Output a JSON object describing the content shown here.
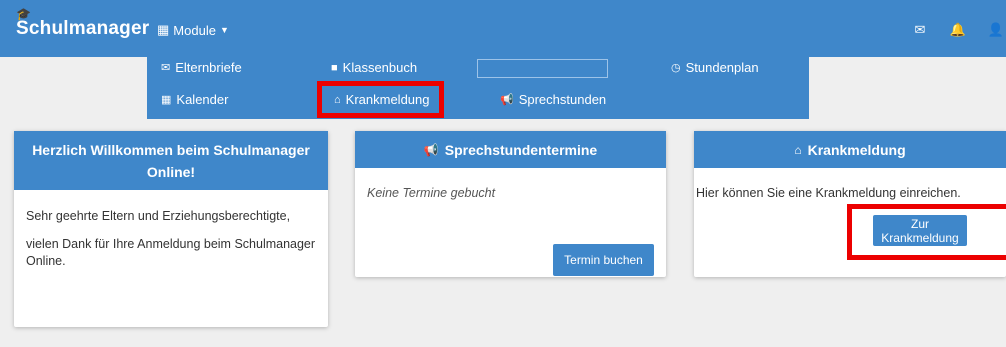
{
  "navbar": {
    "brand": "Schulmanager",
    "module_label": "Module",
    "icons": [
      "envelope-icon",
      "bell-icon",
      "user-icon"
    ]
  },
  "menu": {
    "items": [
      {
        "name": "elternbriefe",
        "label": "Elternbriefe",
        "icon": "✉"
      },
      {
        "name": "klassenbuch",
        "label": "Klassenbuch",
        "icon": "■"
      },
      {
        "name": "stundenplan",
        "label": "Stundenplan",
        "icon": "◷"
      },
      {
        "name": "kalender",
        "label": "Kalender",
        "icon": "▦"
      },
      {
        "name": "krankmeldung",
        "label": "Krankmeldung",
        "icon": "⌂"
      },
      {
        "name": "sprechstunden",
        "label": "Sprechstunden",
        "icon": "📢"
      }
    ]
  },
  "cards": {
    "welcome": {
      "title": "Herzlich Willkommen beim Schulmanager Online!",
      "para1": "Sehr geehrte Eltern und Erziehungsberechtigte,",
      "para2": "vielen Dank für Ihre Anmeldung beim Schulmanager Online."
    },
    "sprechstunden": {
      "title": "Sprechstundentermine",
      "empty": "Keine Termine gebucht",
      "button": "Termin buchen"
    },
    "krankmeldung": {
      "title": "Krankmeldung",
      "text": "Hier können Sie eine Krankmeldung einreichen.",
      "button": "Zur Krankmeldung"
    }
  },
  "colors": {
    "primary": "#3f87ca",
    "highlight": "#ec0000",
    "background": "#efefef"
  }
}
